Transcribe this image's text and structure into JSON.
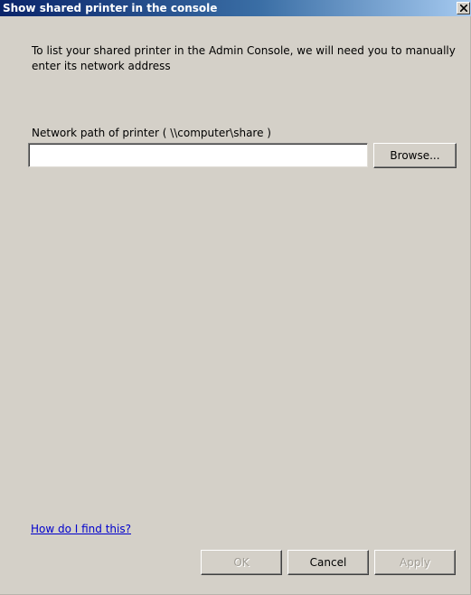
{
  "window": {
    "title": "Show shared printer in the console",
    "close_label": "×"
  },
  "intro_text": "To list your shared printer in the Admin Console, we will need you to manually enter its network address",
  "path_field": {
    "label": "Network path of printer ( \\\\computer\\share )",
    "value": "",
    "placeholder": ""
  },
  "buttons": {
    "browse": "Browse...",
    "ok": "OK",
    "cancel": "Cancel",
    "apply": "Apply"
  },
  "help_link": "How do I find this?",
  "colors": {
    "titlebar_start": "#0a246a",
    "dialog_bg": "#d4d0c8",
    "link": "#0000cc",
    "disabled_text": "#a09c94"
  },
  "icons": {
    "close": "close-icon"
  }
}
